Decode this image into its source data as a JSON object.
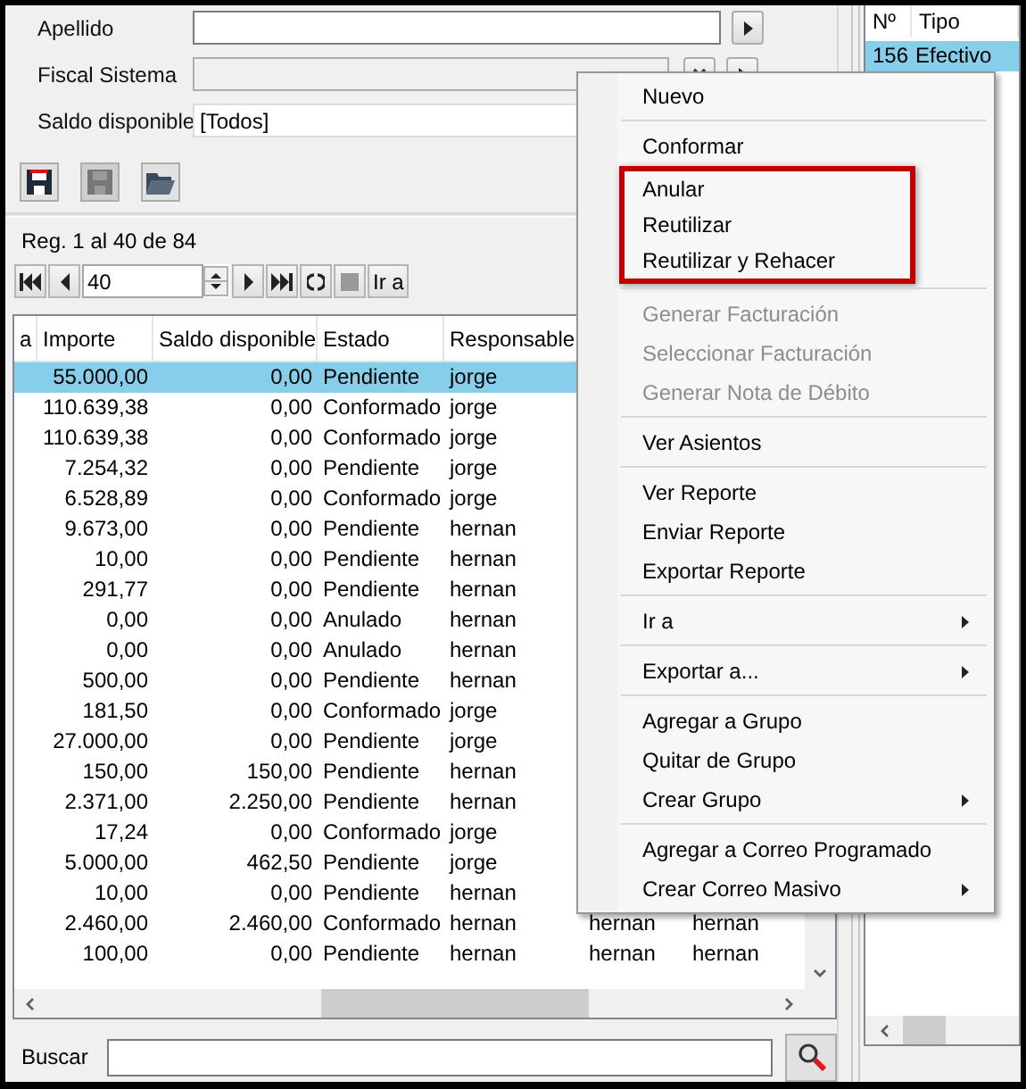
{
  "filters": [
    {
      "label": "Apellido",
      "kind": "text",
      "disabled": false,
      "buttons": [
        {
          "kind": "go"
        }
      ]
    },
    {
      "label": "Fiscal Sistema",
      "kind": "text",
      "disabled": true,
      "buttons": [
        {
          "kind": "clear"
        },
        {
          "kind": "go"
        }
      ]
    },
    {
      "label": "Saldo disponible",
      "kind": "combo",
      "value": "[Todos]",
      "disabled": false
    }
  ],
  "toolbar": [
    {
      "kind": "save",
      "disabled": false
    },
    {
      "kind": "save",
      "disabled": true
    },
    {
      "kind": "open",
      "disabled": false
    }
  ],
  "records_label": "Reg. 1 al 40 de 84",
  "pager": {
    "page": "40",
    "go_label": "Ir a"
  },
  "grid": {
    "columns": [
      "a",
      "Importe",
      "Saldo disponible",
      "Estado",
      "Responsable"
    ],
    "rows": [
      {
        "importe": "55.000,00",
        "saldo": "0,00",
        "estado": "Pendiente",
        "responsable": "jorge",
        "selected": true
      },
      {
        "importe": "110.639,38",
        "saldo": "0,00",
        "estado": "Conformado",
        "responsable": "jorge",
        "selected": false
      },
      {
        "importe": "110.639,38",
        "saldo": "0,00",
        "estado": "Conformado",
        "responsable": "jorge",
        "selected": false
      },
      {
        "importe": "7.254,32",
        "saldo": "0,00",
        "estado": "Pendiente",
        "responsable": "jorge",
        "selected": false
      },
      {
        "importe": "6.528,89",
        "saldo": "0,00",
        "estado": "Conformado",
        "responsable": "jorge",
        "selected": false
      },
      {
        "importe": "9.673,00",
        "saldo": "0,00",
        "estado": "Pendiente",
        "responsable": "hernan",
        "selected": false
      },
      {
        "importe": "10,00",
        "saldo": "0,00",
        "estado": "Pendiente",
        "responsable": "hernan",
        "selected": false
      },
      {
        "importe": "291,77",
        "saldo": "0,00",
        "estado": "Pendiente",
        "responsable": "hernan",
        "selected": false
      },
      {
        "importe": "0,00",
        "saldo": "0,00",
        "estado": "Anulado",
        "responsable": "hernan",
        "selected": false
      },
      {
        "importe": "0,00",
        "saldo": "0,00",
        "estado": "Anulado",
        "responsable": "hernan",
        "selected": false
      },
      {
        "importe": "500,00",
        "saldo": "0,00",
        "estado": "Pendiente",
        "responsable": "hernan",
        "selected": false
      },
      {
        "importe": "181,50",
        "saldo": "0,00",
        "estado": "Conformado",
        "responsable": "jorge",
        "selected": false
      },
      {
        "importe": "27.000,00",
        "saldo": "0,00",
        "estado": "Pendiente",
        "responsable": "jorge",
        "selected": false
      },
      {
        "importe": "150,00",
        "saldo": "150,00",
        "estado": "Pendiente",
        "responsable": "hernan",
        "selected": false
      },
      {
        "importe": "2.371,00",
        "saldo": "2.250,00",
        "estado": "Pendiente",
        "responsable": "hernan",
        "selected": false
      },
      {
        "importe": "17,24",
        "saldo": "0,00",
        "estado": "Conformado",
        "responsable": "jorge",
        "selected": false
      },
      {
        "importe": "5.000,00",
        "saldo": "462,50",
        "estado": "Pendiente",
        "responsable": "jorge",
        "selected": false
      },
      {
        "importe": "10,00",
        "saldo": "0,00",
        "estado": "Pendiente",
        "responsable": "hernan",
        "selected": false
      },
      {
        "importe": "2.460,00",
        "saldo": "2.460,00",
        "estado": "Conformado",
        "responsable": "hernan",
        "column_6": "hernan",
        "column_7": "hernan",
        "selected": false
      },
      {
        "importe": "100,00",
        "saldo": "0,00",
        "estado": "Pendiente",
        "responsable": "hernan",
        "column_6": "hernan",
        "column_7": "hernan",
        "selected": false
      }
    ]
  },
  "search": {
    "label": "Buscar"
  },
  "side": {
    "columns": [
      "Nº",
      "Tipo"
    ],
    "rows": [
      {
        "cells": [
          "156",
          "Efectivo"
        ],
        "selected": true
      }
    ]
  },
  "context_menu": {
    "groups": [
      {
        "items": [
          {
            "label": "Nuevo",
            "disabled": false,
            "submenu": false,
            "highlighted": false
          }
        ]
      },
      {
        "items": [
          {
            "label": "Conformar",
            "disabled": false,
            "submenu": false,
            "highlighted": false
          },
          {
            "label": "Anular",
            "disabled": false,
            "submenu": false,
            "highlighted": true
          },
          {
            "label": "Reutilizar",
            "disabled": false,
            "submenu": false,
            "highlighted": true
          },
          {
            "label": "Reutilizar y Rehacer",
            "disabled": false,
            "submenu": false,
            "highlighted": true
          }
        ]
      },
      {
        "items": [
          {
            "label": "Generar Facturación",
            "disabled": true,
            "submenu": false,
            "highlighted": false
          },
          {
            "label": "Seleccionar Facturación",
            "disabled": true,
            "submenu": false,
            "highlighted": false
          },
          {
            "label": "Generar Nota de Débito",
            "disabled": true,
            "submenu": false,
            "highlighted": false
          }
        ]
      },
      {
        "items": [
          {
            "label": "Ver Asientos",
            "disabled": false,
            "submenu": false,
            "highlighted": false
          }
        ]
      },
      {
        "items": [
          {
            "label": "Ver Reporte",
            "disabled": false,
            "submenu": false,
            "highlighted": false
          },
          {
            "label": "Enviar Reporte",
            "disabled": false,
            "submenu": false,
            "highlighted": false
          },
          {
            "label": "Exportar Reporte",
            "disabled": false,
            "submenu": false,
            "highlighted": false
          }
        ]
      },
      {
        "items": [
          {
            "label": "Ir a",
            "disabled": false,
            "submenu": true,
            "highlighted": false
          }
        ]
      },
      {
        "items": [
          {
            "label": "Exportar a...",
            "disabled": false,
            "submenu": true,
            "highlighted": false
          }
        ]
      },
      {
        "items": [
          {
            "label": "Agregar a Grupo",
            "disabled": false,
            "submenu": false,
            "highlighted": false
          },
          {
            "label": "Quitar de Grupo",
            "disabled": false,
            "submenu": false,
            "highlighted": false
          },
          {
            "label": "Crear Grupo",
            "disabled": false,
            "submenu": true,
            "highlighted": false
          }
        ]
      },
      {
        "items": [
          {
            "label": "Agregar a Correo Programado",
            "disabled": false,
            "submenu": false,
            "highlighted": false
          },
          {
            "label": "Crear Correo Masivo",
            "disabled": false,
            "submenu": true,
            "highlighted": false
          }
        ]
      }
    ]
  }
}
